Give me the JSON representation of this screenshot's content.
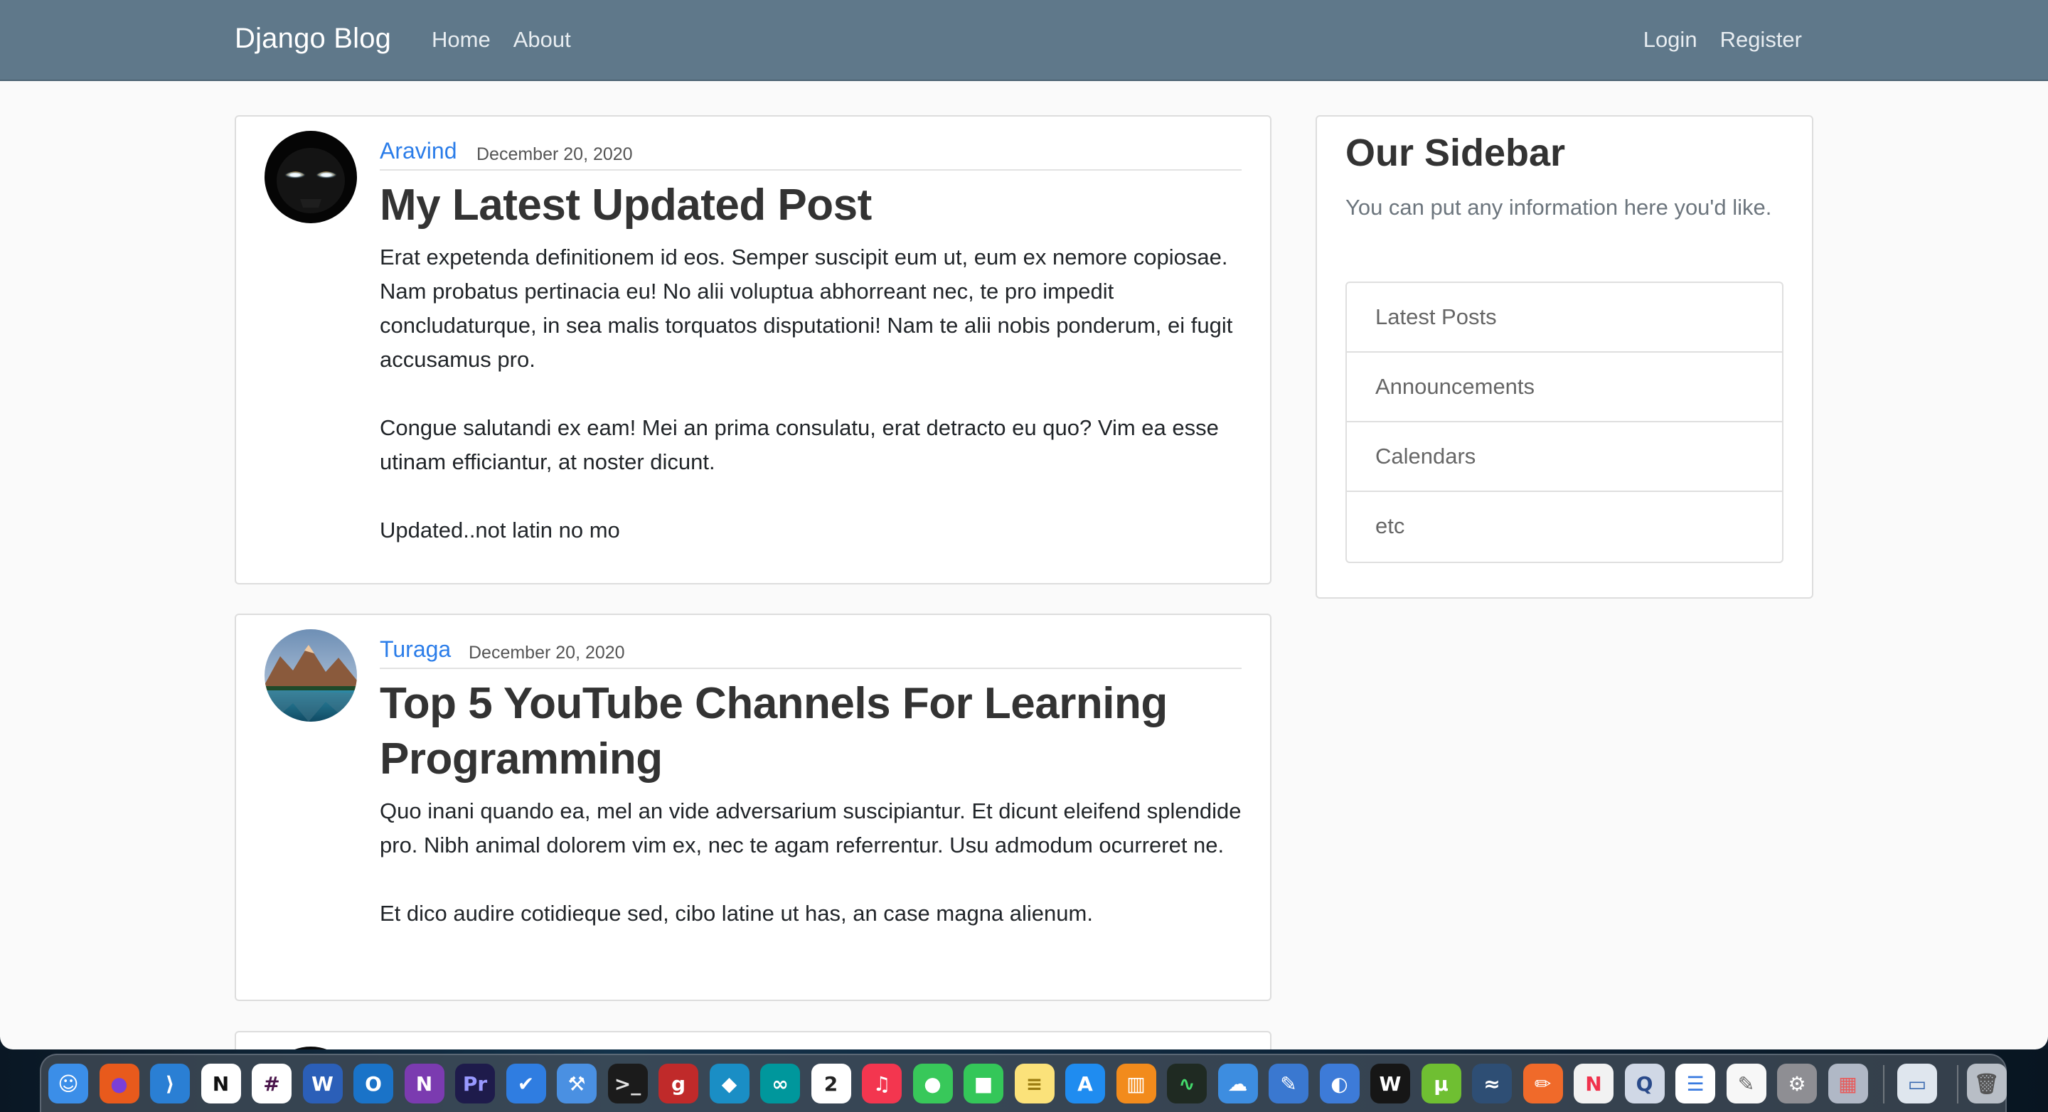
{
  "navbar": {
    "brand": "Django Blog",
    "left_links": [
      "Home",
      "About"
    ],
    "right_links": [
      "Login",
      "Register"
    ]
  },
  "posts": [
    {
      "author": "Aravind",
      "date": "December 20, 2020",
      "title": "My Latest Updated Post",
      "paragraphs": [
        "Erat expetenda definitionem id eos. Semper suscipit eum ut, eum ex nemore copiosae. Nam probatus pertinacia eu! No alii voluptua abhorreant nec, te pro impedit concludaturque, in sea malis torquatos disputationi! Nam te alii nobis ponderum, ei fugit accusamus pro.",
        "Congue salutandi ex eam! Mei an prima consulatu, erat detracto eu quo? Vim ea esse utinam efficiantur, at noster dicunt.",
        "Updated..not latin no mo"
      ]
    },
    {
      "author": "Turaga",
      "date": "December 20, 2020",
      "title": "Top 5 YouTube Channels For Learning Programming",
      "paragraphs": [
        "Quo inani quando ea, mel an vide adversarium suscipiantur. Et dicunt eleifend splendide pro. Nibh animal dolorem vim ex, nec te agam referrentur. Usu admodum ocurreret ne.",
        "Et dico audire cotidieque sed, cibo latine ut has, an case magna alienum."
      ]
    }
  ],
  "sidebar": {
    "title": "Our Sidebar",
    "text": "You can put any information here you'd like.",
    "items": [
      "Latest Posts",
      "Announcements",
      "Calendars",
      "etc"
    ]
  },
  "dock": {
    "apps": [
      {
        "icon": "finder-icon",
        "bg": "#3b8ee8",
        "glyph": "☺",
        "fg": "#ffffff"
      },
      {
        "icon": "firefox-icon",
        "bg": "#e85a1c",
        "glyph": "●",
        "fg": "#7b3fd8"
      },
      {
        "icon": "vscode-icon",
        "bg": "#2a7fd4",
        "glyph": "⟩",
        "fg": "#ffffff"
      },
      {
        "icon": "notion-icon",
        "bg": "#ffffff",
        "glyph": "N",
        "fg": "#111111"
      },
      {
        "icon": "slack-icon",
        "bg": "#ffffff",
        "glyph": "#",
        "fg": "#4a154b"
      },
      {
        "icon": "word-icon",
        "bg": "#2b5fb8",
        "glyph": "W",
        "fg": "#ffffff"
      },
      {
        "icon": "outlook-icon",
        "bg": "#1a73c8",
        "glyph": "O",
        "fg": "#ffffff"
      },
      {
        "icon": "onenote-icon",
        "bg": "#7b3bb0",
        "glyph": "N",
        "fg": "#ffffff"
      },
      {
        "icon": "premiere-icon",
        "bg": "#1e1b4b",
        "glyph": "Pr",
        "fg": "#9999ff"
      },
      {
        "icon": "tasks-icon",
        "bg": "#2f7de1",
        "glyph": "✔",
        "fg": "#ffffff"
      },
      {
        "icon": "xcode-icon",
        "bg": "#4a90e2",
        "glyph": "⚒",
        "fg": "#ffffff"
      },
      {
        "icon": "terminal-icon",
        "bg": "#1b1b1b",
        "glyph": ">_",
        "fg": "#e0e0e0"
      },
      {
        "icon": "git-icon",
        "bg": "#c02a2a",
        "glyph": "g",
        "fg": "#ffffff"
      },
      {
        "icon": "kodi-icon",
        "bg": "#1a8ec5",
        "glyph": "◆",
        "fg": "#ffffff"
      },
      {
        "icon": "arduino-icon",
        "bg": "#00979c",
        "glyph": "∞",
        "fg": "#ffffff"
      },
      {
        "icon": "calendar-icon",
        "bg": "#ffffff",
        "glyph": "2",
        "fg": "#222222"
      },
      {
        "icon": "music-icon",
        "bg": "#f3364f",
        "glyph": "♫",
        "fg": "#ffffff"
      },
      {
        "icon": "messages-icon",
        "bg": "#38c85a",
        "glyph": "●",
        "fg": "#ffffff"
      },
      {
        "icon": "facetime-icon",
        "bg": "#34c759",
        "glyph": "■",
        "fg": "#ffffff"
      },
      {
        "icon": "notes-icon",
        "bg": "#fbe27a",
        "glyph": "≡",
        "fg": "#9a7b10"
      },
      {
        "icon": "appstore-icon",
        "bg": "#1f8cf0",
        "glyph": "A",
        "fg": "#ffffff"
      },
      {
        "icon": "books-icon",
        "bg": "#f28b1c",
        "glyph": "▥",
        "fg": "#ffffff"
      },
      {
        "icon": "activity-monitor-icon",
        "bg": "#1f2a22",
        "glyph": "∿",
        "fg": "#43d96b"
      },
      {
        "icon": "weather-icon",
        "bg": "#3d8de0",
        "glyph": "☁",
        "fg": "#ffffff"
      },
      {
        "icon": "instruments-icon",
        "bg": "#3a78d0",
        "glyph": "✎",
        "fg": "#ffffff"
      },
      {
        "icon": "proxyman-icon",
        "bg": "#3d7bd8",
        "glyph": "◐",
        "fg": "#ffffff"
      },
      {
        "icon": "webstorm-icon",
        "bg": "#161616",
        "glyph": "W",
        "fg": "#ffffff"
      },
      {
        "icon": "utorrent-icon",
        "bg": "#6fbf32",
        "glyph": "µ",
        "fg": "#ffffff"
      },
      {
        "icon": "mysql-workbench-icon",
        "bg": "#2e4e74",
        "glyph": "≈",
        "fg": "#ffffff"
      },
      {
        "icon": "pencil-app-icon",
        "bg": "#f06a2a",
        "glyph": "✏",
        "fg": "#ffffff"
      },
      {
        "icon": "news-icon",
        "bg": "#f2f2f2",
        "glyph": "N",
        "fg": "#f0324c"
      },
      {
        "icon": "quicktime-icon",
        "bg": "#d0d8e6",
        "glyph": "Q",
        "fg": "#2a4a8a"
      },
      {
        "icon": "reminders-icon",
        "bg": "#ffffff",
        "glyph": "☰",
        "fg": "#3a7be0"
      },
      {
        "icon": "textedit-icon",
        "bg": "#f7f7f7",
        "glyph": "✎",
        "fg": "#666666"
      },
      {
        "icon": "system-preferences-icon",
        "bg": "#8e8e93",
        "glyph": "⚙",
        "fg": "#ffffff"
      },
      {
        "icon": "launchpad-icon",
        "bg": "#b0b8c6",
        "glyph": "▦",
        "fg": "#e85a5a"
      },
      {
        "icon": "preview-icon",
        "bg": "#dfe6ee",
        "glyph": "▭",
        "fg": "#3a6ab0"
      },
      {
        "icon": "trash-icon",
        "bg": "#b8bec6",
        "glyph": "🗑",
        "fg": "#555555"
      }
    ]
  }
}
